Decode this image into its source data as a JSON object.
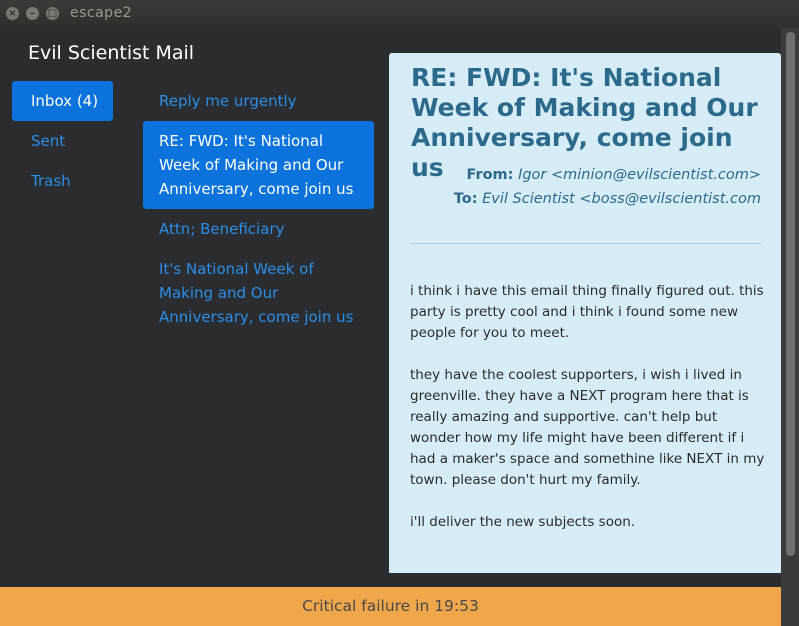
{
  "window": {
    "title": "escape2",
    "close_glyph": "×",
    "minimize_glyph": "–",
    "maximize_glyph": "□"
  },
  "app": {
    "title": "Evil Scientist Mail"
  },
  "folders": [
    {
      "label": "Inbox (4)",
      "active": true
    },
    {
      "label": "Sent",
      "active": false
    },
    {
      "label": "Trash",
      "active": false
    }
  ],
  "messages": [
    {
      "subject": "Reply me urgently",
      "active": false
    },
    {
      "subject": "RE: FWD: It's National Week of Making and Our Anniversary, come join us",
      "active": true
    },
    {
      "subject": "Attn; Beneficiary",
      "active": false
    },
    {
      "subject": "It's National Week of Making and Our Anniversary, come join us",
      "active": false
    }
  ],
  "reader": {
    "subject": "RE: FWD: It's National Week of Making and Our Anniversary, come join us",
    "from_label": "From:",
    "from_value": "Igor <minion@evilscientist.com>",
    "to_label": "To:",
    "to_value": "Evil Scientist <boss@evilscientist.com",
    "body": [
      "i think i have this email thing finally figured out. this party is pretty cool and i think i found some new people for you to meet.",
      "they have the coolest supporters, i wish i lived in greenville. they have a NEXT program here that is really amazing and supportive. can't help but wonder how my life might have been different if i had a maker's space and somethine like NEXT in my town. please don't hurt my family.",
      "i'll deliver the new subjects soon."
    ]
  },
  "status": {
    "text": "Critical failure in 19:53"
  },
  "colors": {
    "accent": "#0b73db",
    "link": "#2a8ee8",
    "reader_bg": "#d6edf8",
    "reader_text": "#2c6a8c",
    "status_bg": "#f0a64a"
  }
}
